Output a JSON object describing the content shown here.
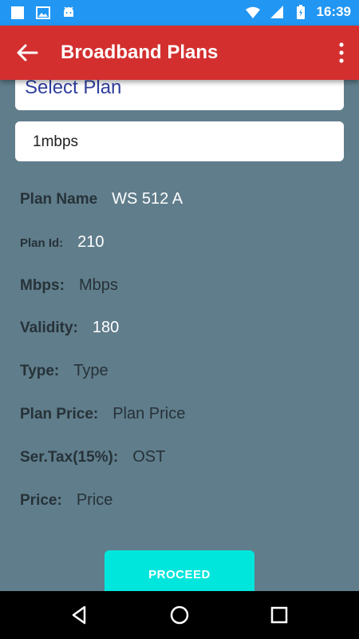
{
  "status_bar": {
    "time": "16:39",
    "left_icons": [
      "square-icon",
      "image-icon",
      "android-icon"
    ],
    "right_icons": [
      "wifi-icon",
      "signal-icon",
      "battery-icon"
    ]
  },
  "app_bar": {
    "title": "Broadband Plans",
    "back_icon": "back-arrow-icon",
    "menu_icon": "more-vert-icon",
    "color": "#d32f2f"
  },
  "select_plan": {
    "label": "Select Plan"
  },
  "speed_field": {
    "value": "1mbps"
  },
  "details": {
    "plan_name": {
      "label": "Plan Name",
      "value": "WS 512 A"
    },
    "plan_id": {
      "label": "Plan Id:",
      "value": "210"
    },
    "mbps": {
      "label": "Mbps:",
      "value": "Mbps"
    },
    "validity": {
      "label": "Validity:",
      "value": "180"
    },
    "type": {
      "label": "Type:",
      "value": "Type"
    },
    "plan_price": {
      "label": "Plan Price:",
      "value": "Plan Price"
    },
    "ser_tax": {
      "label": "Ser.Tax(15%):",
      "value": "OST"
    },
    "price": {
      "label": "Price:",
      "value": "Price"
    }
  },
  "proceed": {
    "label": "PROCEED",
    "color": "#00e5dc"
  },
  "background_color": "#607d8b",
  "status_bar_color": "#2196f3"
}
